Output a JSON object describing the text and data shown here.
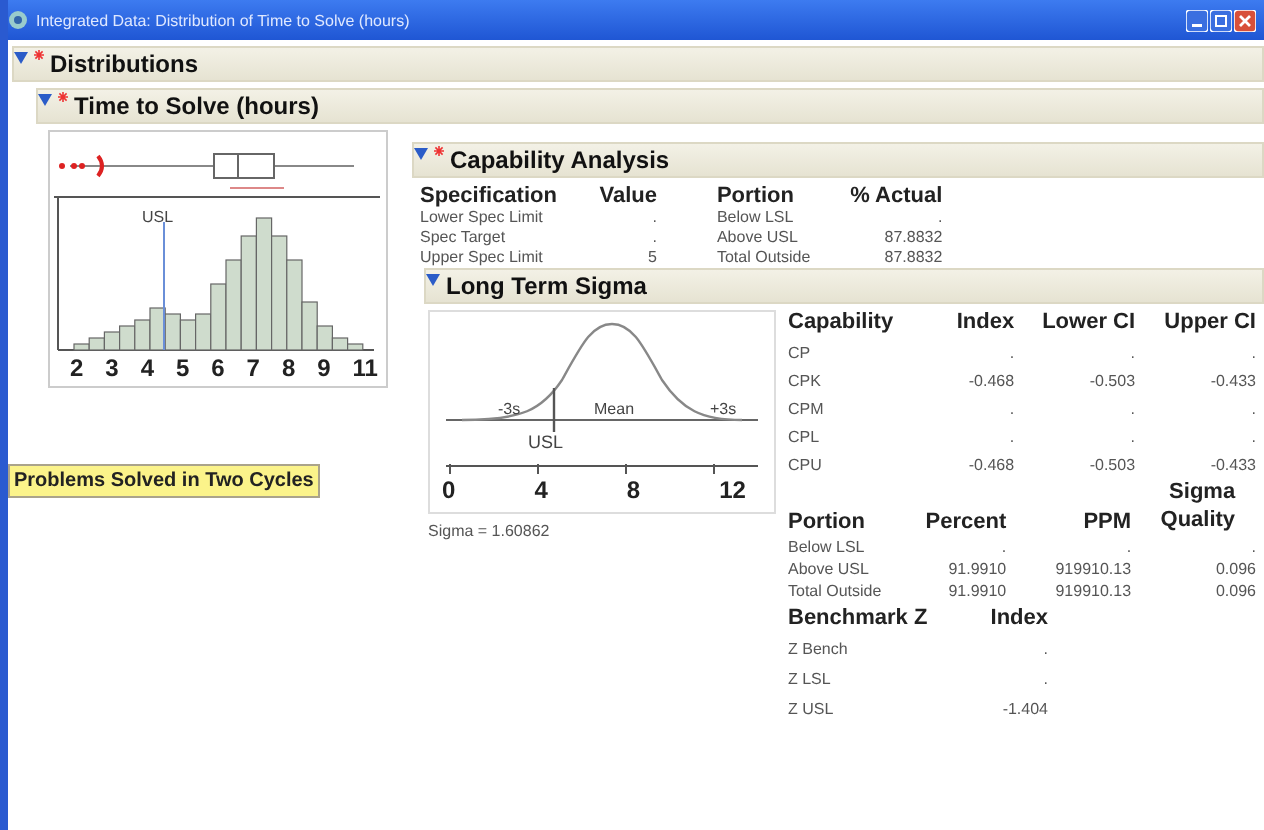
{
  "window": {
    "title": "Integrated Data: Distribution of Time to Solve (hours)"
  },
  "distributions": {
    "title": "Distributions",
    "expanded": true
  },
  "variable": {
    "title": "Time to Solve (hours)",
    "expanded": true,
    "histogram": {
      "usl_label": "USL",
      "axis_labels": [
        "2",
        "3",
        "4",
        "5",
        "6",
        "7",
        "8",
        "9",
        "11"
      ]
    }
  },
  "note": "Problems Solved in Two Cycles",
  "capability": {
    "title": "Capability Analysis",
    "expanded": true,
    "spec_columns": [
      "Specification",
      "Value"
    ],
    "spec_rows": [
      [
        "Lower Spec Limit",
        "."
      ],
      [
        "Spec Target",
        "."
      ],
      [
        "Upper Spec Limit",
        "5"
      ]
    ],
    "portion_columns": [
      "Portion",
      "% Actual"
    ],
    "portion_rows": [
      [
        "Below LSL",
        "."
      ],
      [
        "Above USL",
        "87.8832"
      ],
      [
        "Total Outside",
        "87.8832"
      ]
    ]
  },
  "long_term": {
    "title": "Long Term Sigma",
    "expanded": true,
    "curve": {
      "labels": [
        "-3s",
        "Mean",
        "+3s"
      ],
      "usl_label": "USL",
      "axis_labels": [
        "0",
        "4",
        "8",
        "12"
      ]
    },
    "sigma": "Sigma = 1.60862",
    "index_columns": [
      "Capability",
      "Index",
      "Lower CI",
      "Upper CI"
    ],
    "index_rows": [
      [
        "CP",
        ".",
        ".",
        "."
      ],
      [
        "CPK",
        "-0.468",
        "-0.503",
        "-0.433"
      ],
      [
        "CPM",
        ".",
        ".",
        "."
      ],
      [
        "CPL",
        ".",
        ".",
        "."
      ],
      [
        "CPU",
        "-0.468",
        "-0.503",
        "-0.433"
      ]
    ],
    "portion_columns": [
      "Portion",
      "Percent",
      "PPM",
      "Sigma Quality"
    ],
    "portion_rows": [
      [
        "Below LSL",
        ".",
        ".",
        "."
      ],
      [
        "Above USL",
        "91.9910",
        "919910.13",
        "0.096"
      ],
      [
        "Total Outside",
        "91.9910",
        "919910.13",
        "0.096"
      ]
    ],
    "bench_columns": [
      "Benchmark Z",
      "Index"
    ],
    "bench_rows": [
      [
        "Z Bench",
        "."
      ],
      [
        "Z LSL",
        "."
      ],
      [
        "Z USL",
        "-1.404"
      ]
    ]
  }
}
